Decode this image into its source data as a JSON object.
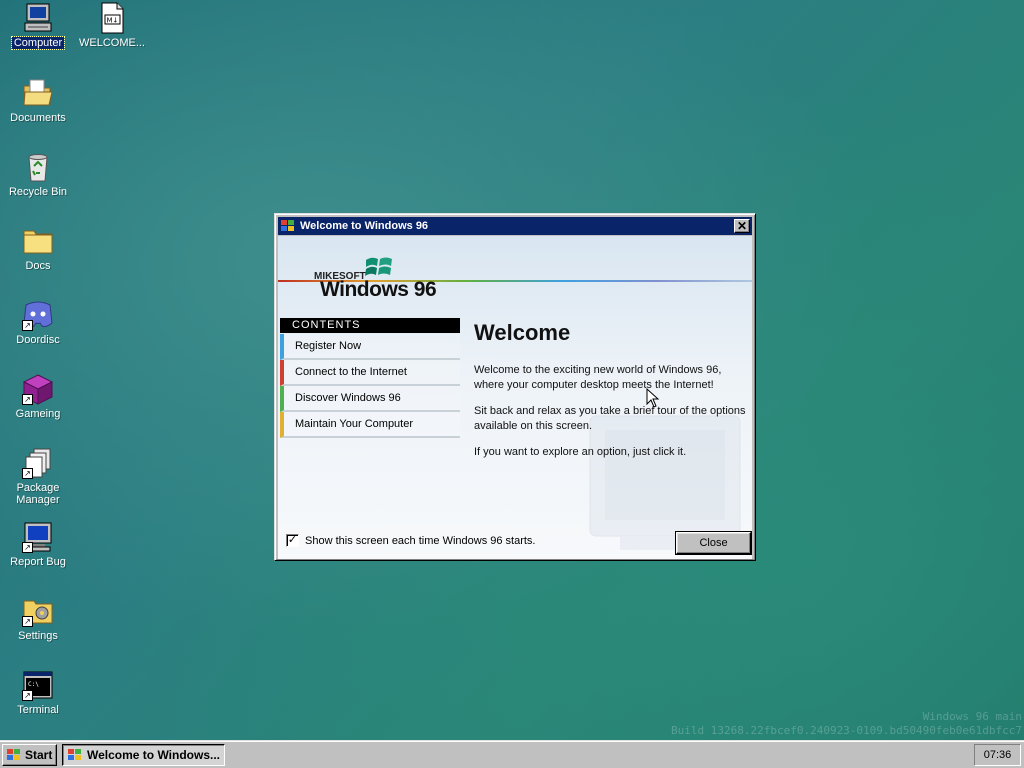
{
  "desktop": {
    "icons": [
      {
        "label": "Computer"
      },
      {
        "label": "WELCOME..."
      },
      {
        "label": "Documents"
      },
      {
        "label": "Recycle Bin"
      },
      {
        "label": "Docs"
      },
      {
        "label": "Doordisc"
      },
      {
        "label": "Gameing"
      },
      {
        "label": "Package Manager"
      },
      {
        "label": "Report Bug"
      },
      {
        "label": "Settings"
      },
      {
        "label": "Terminal"
      }
    ],
    "watermark": {
      "line1": "Windows 96 main",
      "line2": "Build 13268.22fbcef0.240923-0109.bd50490feb0e61dbfcc7"
    }
  },
  "window": {
    "title": "Welcome to Windows 96",
    "close_glyph": "✕",
    "brand_small": "MIKESOFT",
    "brand_big": "Windows 96",
    "contents_header": "CONTENTS",
    "menu": [
      {
        "label": "Register Now",
        "color": "#3fa0e0"
      },
      {
        "label": "Connect to the Internet",
        "color": "#d04030"
      },
      {
        "label": "Discover Windows 96",
        "color": "#50b050"
      },
      {
        "label": "Maintain Your Computer",
        "color": "#e0b030"
      }
    ],
    "heading": "Welcome",
    "paragraphs": [
      "Welcome to the exciting new world of Windows 96, where your computer desktop meets the Internet!",
      "Sit back and relax as you take a brief tour of the options available on this screen.",
      "If you want to explore an option, just click it."
    ],
    "show_checkbox": {
      "label": "Show this screen each time Windows 96 starts.",
      "checked": true,
      "mark": "✓"
    },
    "close_button": "Close"
  },
  "taskbar": {
    "start_label": "Start",
    "task_label": "Welcome to Windows...",
    "clock": "07:36"
  },
  "colors": {
    "titlebar": "#0a246a",
    "desktop": "#2b7e82",
    "chrome": "#c0c0c0"
  }
}
